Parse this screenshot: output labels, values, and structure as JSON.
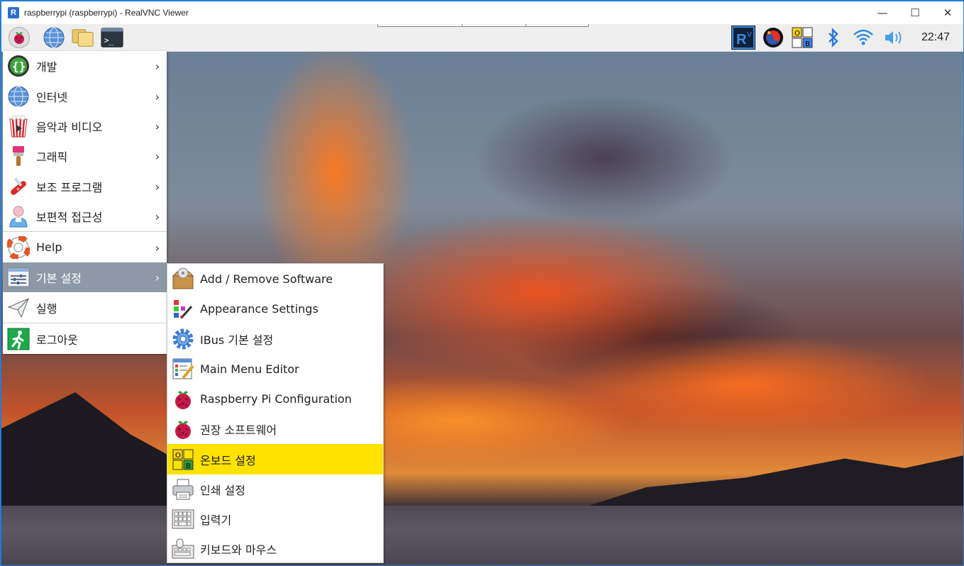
{
  "window": {
    "title": "raspberrypi (raspberrypi) - RealVNC Viewer",
    "app_icon": "realvnc-icon",
    "app_icon_letter": "R",
    "minimize": "—",
    "maximize": "☐",
    "close": "✕"
  },
  "taskbar": {
    "launchers": [
      "raspberry-menu-icon",
      "web-browser-icon",
      "file-manager-icon",
      "terminal-icon"
    ],
    "tray": [
      "vnc-server-icon",
      "input-method-icon",
      "onboard-keyboard-icon",
      "bluetooth-icon",
      "wifi-icon",
      "volume-icon"
    ],
    "vnc_tray_letters": "V",
    "onboard_letters": [
      "O",
      "B"
    ],
    "clock": "22:47"
  },
  "main_menu": {
    "items": [
      {
        "label": "개발",
        "icon": "programming-icon",
        "has_submenu": true
      },
      {
        "label": "인터넷",
        "icon": "internet-globe-icon",
        "has_submenu": true
      },
      {
        "label": "음악과 비디오",
        "icon": "sound-video-icon",
        "has_submenu": true
      },
      {
        "label": "그래픽",
        "icon": "graphics-brush-icon",
        "has_submenu": true
      },
      {
        "label": "보조 프로그램",
        "icon": "accessories-knife-icon",
        "has_submenu": true
      },
      {
        "label": "보편적 접근성",
        "icon": "universal-access-icon",
        "has_submenu": true
      },
      {
        "label": "Help",
        "icon": "help-lifebuoy-icon",
        "has_submenu": true
      },
      {
        "label": "기본 설정",
        "icon": "preferences-icon",
        "has_submenu": true,
        "highlighted": true
      },
      {
        "label": "실행",
        "icon": "run-paper-plane-icon",
        "has_submenu": false
      },
      {
        "label": "로그아웃",
        "icon": "logout-icon",
        "has_submenu": false
      }
    ],
    "arrow": "›"
  },
  "preferences_submenu": {
    "items": [
      {
        "label": "Add / Remove Software",
        "icon": "package-icon"
      },
      {
        "label": "Appearance Settings",
        "icon": "appearance-icon"
      },
      {
        "label": "IBus 기본 설정",
        "icon": "ibus-gear-icon"
      },
      {
        "label": "Main Menu Editor",
        "icon": "menu-editor-icon"
      },
      {
        "label": "Raspberry Pi Configuration",
        "icon": "raspberry-config-icon"
      },
      {
        "label": "권장 소프트웨어",
        "icon": "recommended-software-icon"
      },
      {
        "label": "온보드 설정",
        "icon": "onboard-settings-icon",
        "highlighted": true
      },
      {
        "label": "인쇄 설정",
        "icon": "printer-icon"
      },
      {
        "label": "입력기",
        "icon": "input-method-keyboard-icon"
      },
      {
        "label": "키보드와 마우스",
        "icon": "keyboard-mouse-icon"
      }
    ]
  },
  "colors": {
    "menu_highlight": "#8d99a6",
    "submenu_highlight": "#ffe200",
    "window_border": "#2a7fd4"
  }
}
